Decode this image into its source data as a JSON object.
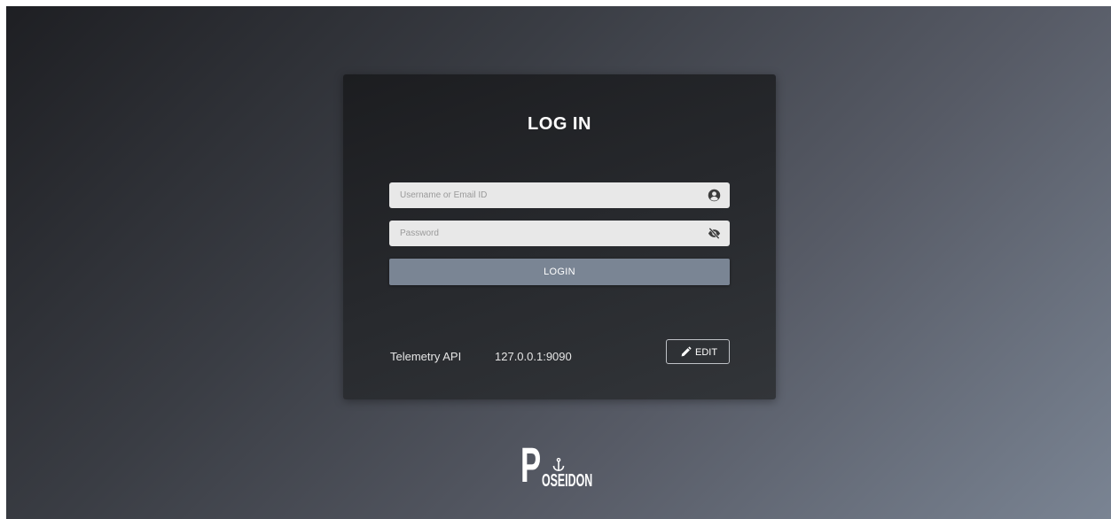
{
  "login": {
    "title": "LOG IN",
    "username_placeholder": "Username or Email ID",
    "password_placeholder": "Password",
    "username_icon": "user-circle-icon",
    "password_icon": "eye-slash-icon",
    "submit_label": "LOGIN"
  },
  "telemetry": {
    "label": "Telemetry API",
    "value": "127.0.0.1:9090",
    "edit_label": "EDIT",
    "edit_icon": "pencil-icon"
  },
  "brand": {
    "logo_initial": "P",
    "logo_rest": "OSEIDON",
    "logo_icon": "anchor-icon"
  },
  "colors": {
    "card_background": "#27292d",
    "login_button": "#7a8594",
    "input_background": "#e8e8e8"
  }
}
